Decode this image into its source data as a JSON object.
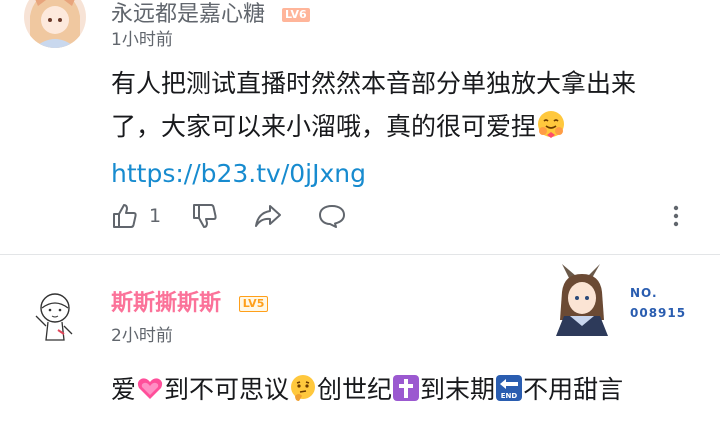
{
  "comments": [
    {
      "username": "永远都是嘉心糖",
      "level": "LV6",
      "time": "1小时前",
      "text_line1": "有人把测试直播时然然本音部分单独放大拿出来",
      "text_line2": "了，大家可以来小溜哦，真的很可爱捏",
      "emoji_after_line2": "hugging-face-emoji",
      "link": "https://b23.tv/0jJxng",
      "like_count": "1"
    },
    {
      "username": "斯斯撕斯斯",
      "level": "LV5",
      "time": "2小时前",
      "badge_label": "NO.",
      "badge_number": "008915",
      "text_segments": [
        "爱",
        "到不可思议",
        "创世纪",
        "到末期",
        "不用甜言"
      ],
      "emojis": [
        "pink-heart-emoji",
        "thinking-face-emoji",
        "latin-cross-emoji",
        "end-arrow-emoji"
      ]
    }
  ],
  "colors": {
    "username_pink": "#fb7299",
    "link_blue": "#178bcf",
    "level6_red": "#ff6a2a",
    "level5_orange": "#ff9f1a"
  }
}
